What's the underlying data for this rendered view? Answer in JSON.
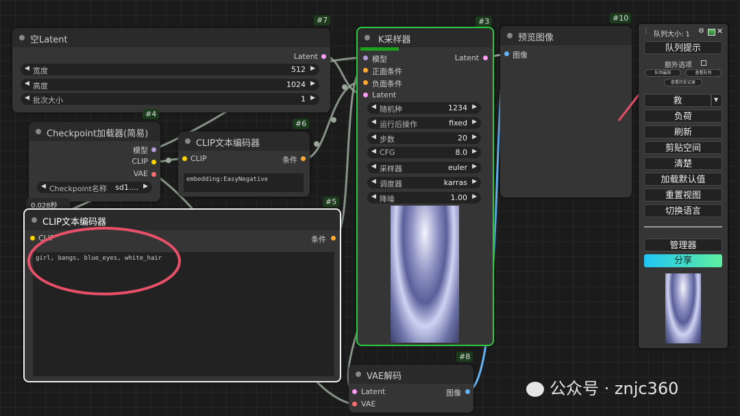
{
  "nodes": {
    "empty_latent": {
      "badge": "#7",
      "title": "空Latent",
      "out_latent": "Latent",
      "widgets": [
        {
          "label": "宽度",
          "value": "512"
        },
        {
          "label": "高度",
          "value": "1024"
        },
        {
          "label": "批次大小",
          "value": "1"
        }
      ]
    },
    "checkpoint": {
      "badge": "#4",
      "title": "Checkpoint加载器(简易)",
      "out_model": "模型",
      "out_clip": "CLIP",
      "out_vae": "VAE",
      "ckpt_label": "Checkpoint名称",
      "ckpt_value": "sd1...."
    },
    "clip_neg": {
      "badge": "#6",
      "title": "CLIP文本编码器",
      "in_clip": "CLIP",
      "out_cond": "条件",
      "text": "embedding:EasyNegative"
    },
    "clip_pos": {
      "badge": "#5",
      "title": "CLIP文本编码器",
      "timing": "0.028秒",
      "in_clip": "CLIP",
      "out_cond": "条件",
      "text": "girl, bangs, blue_eyes,  white_hair"
    },
    "ksampler": {
      "badge": "#3",
      "title": "K采样器",
      "in_model": "模型",
      "in_pos": "正面条件",
      "in_neg": "负面条件",
      "in_latent": "Latent",
      "out_latent": "Latent",
      "widgets": [
        {
          "label": "随机种",
          "value": "1234"
        },
        {
          "label": "运行后操作",
          "value": "fixed"
        },
        {
          "label": "步数",
          "value": "20"
        },
        {
          "label": "CFG",
          "value": "8.0"
        },
        {
          "label": "采样器",
          "value": "euler"
        },
        {
          "label": "调度器",
          "value": "karras"
        },
        {
          "label": "降噪",
          "value": "1.00"
        }
      ]
    },
    "preview": {
      "badge": "#10",
      "title": "预览图像",
      "in_image": "图像"
    },
    "vae_decode": {
      "badge": "#8",
      "title": "VAE解码",
      "in_latent": "Latent",
      "in_vae": "VAE",
      "out_image": "图像"
    }
  },
  "panel": {
    "queue_size": "队列大小: 1",
    "queue_prompt": "队列提示",
    "extra_options": "额外选项",
    "queue_front": "队列最前",
    "view_queue": "查看队列",
    "view_history": "查看历史记录",
    "save": "救",
    "load": "负荷",
    "refresh": "刷新",
    "clipspace": "剪贴空间",
    "clear": "清楚",
    "load_default": "加载默认值",
    "reset_view": "重置视图",
    "switch_lang": "切换语言",
    "manager": "管理器",
    "share": "分享"
  },
  "watermark": "公众号 · znjc360",
  "colors": {
    "model": "#b39ddb",
    "clip": "#ffd500",
    "vae": "#ff6e6e",
    "latent": "#ff9cf9",
    "cond": "#ffa931",
    "image": "#64b5f6",
    "selected": "#2ecc40",
    "annotation": "#e8506a"
  }
}
